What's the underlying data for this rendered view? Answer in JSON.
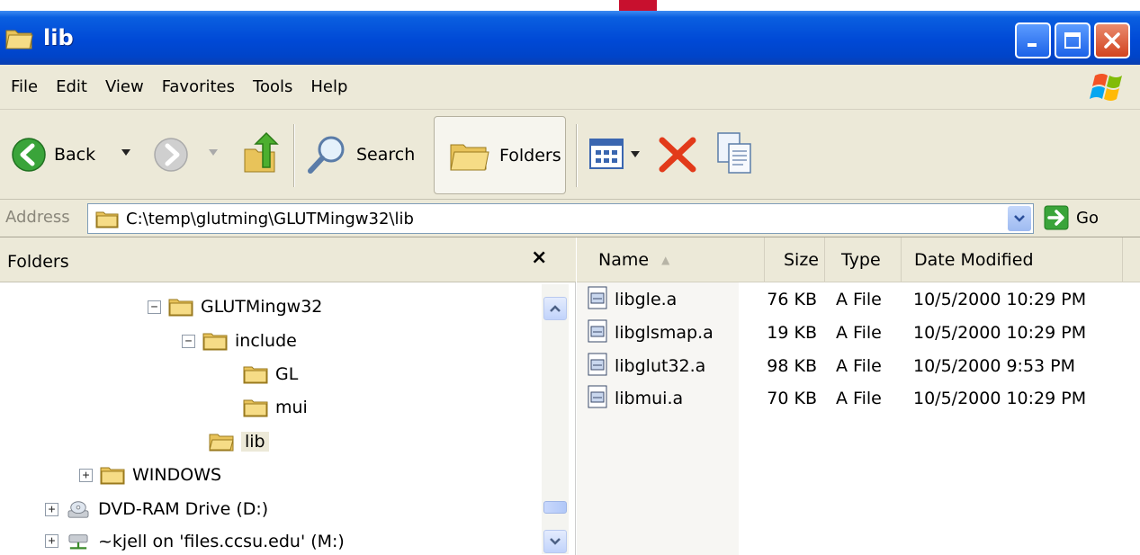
{
  "window": {
    "title": "lib",
    "accent": "#0a5fe0",
    "icon": "folder-icon"
  },
  "menubar": {
    "items": [
      "File",
      "Edit",
      "View",
      "Favorites",
      "Tools",
      "Help"
    ]
  },
  "toolbar": {
    "back_label": "Back",
    "search_label": "Search",
    "folders_label": "Folders"
  },
  "address": {
    "label": "Address",
    "value": "C:\\temp\\glutming\\GLUTMingw32\\lib",
    "go_label": "Go"
  },
  "folders_pane": {
    "title": "Folders",
    "close_glyph": "×",
    "tree": [
      {
        "label": "GLUTMingw32",
        "expander": "−"
      },
      {
        "label": "include",
        "expander": "−"
      },
      {
        "label": "GL"
      },
      {
        "label": "mui"
      },
      {
        "label": "lib",
        "selected": true
      },
      {
        "label": "WINDOWS",
        "expander": "+"
      },
      {
        "label": "DVD-RAM Drive (D:)",
        "expander": "+",
        "icon": "dvd-drive-icon"
      },
      {
        "label": "~kjell on 'files.ccsu.edu' (M:)",
        "expander": "+",
        "icon": "network-drive-icon"
      }
    ]
  },
  "files_pane": {
    "columns": [
      "Name",
      "Size",
      "Type",
      "Date Modified"
    ],
    "sort_indicator": "▲",
    "rows": [
      {
        "name": "libgle.a",
        "size": "76 KB",
        "type": "A File",
        "date": "10/5/2000 10:29 PM"
      },
      {
        "name": "libglsmap.a",
        "size": "19 KB",
        "type": "A File",
        "date": "10/5/2000 10:29 PM"
      },
      {
        "name": "libglut32.a",
        "size": "98 KB",
        "type": "A File",
        "date": "10/5/2000 9:53 PM"
      },
      {
        "name": "libmui.a",
        "size": "70 KB",
        "type": "A File",
        "date": "10/5/2000 10:29 PM"
      }
    ]
  }
}
